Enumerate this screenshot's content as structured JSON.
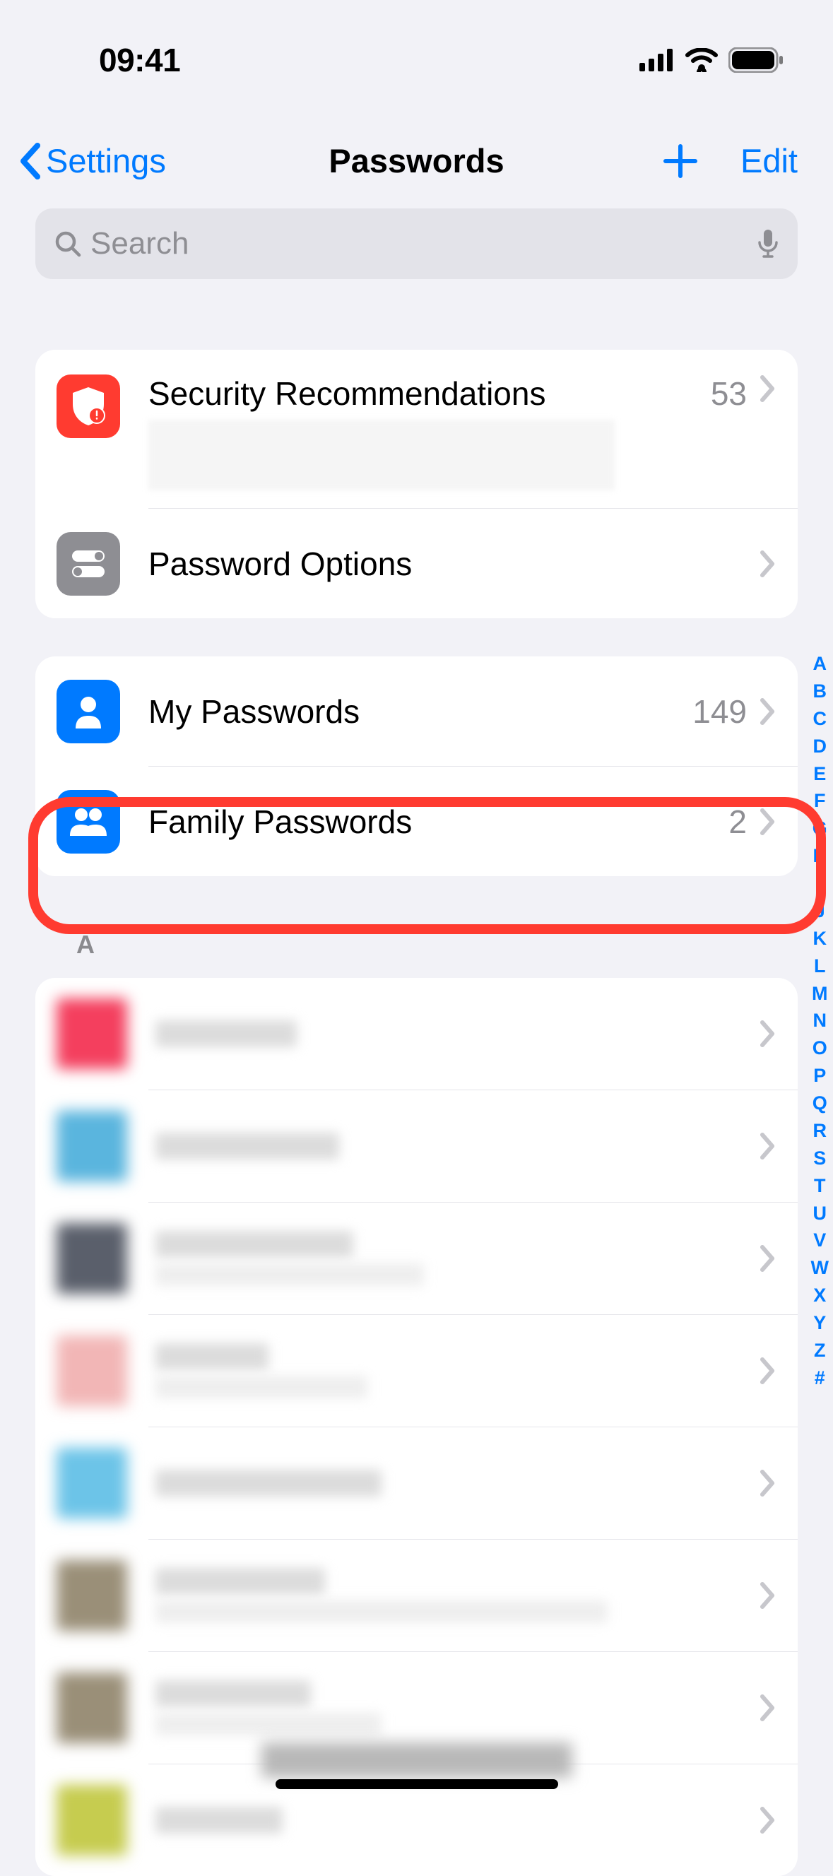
{
  "status": {
    "time": "09:41"
  },
  "nav": {
    "back_label": "Settings",
    "title": "Passwords",
    "edit_label": "Edit"
  },
  "search": {
    "placeholder": "Search"
  },
  "sections": {
    "top": [
      {
        "title": "Security Recommendations",
        "count": "53",
        "icon": "shield-alert",
        "icon_bg": "red"
      },
      {
        "title": "Password Options",
        "count": "",
        "icon": "toggles",
        "icon_bg": "gray"
      }
    ],
    "groups": [
      {
        "title": "My Passwords",
        "count": "149",
        "icon": "person",
        "icon_bg": "blue"
      },
      {
        "title": "Family Passwords",
        "count": "2",
        "icon": "people",
        "icon_bg": "blue"
      }
    ]
  },
  "list": {
    "section_header": "A",
    "items": [
      {
        "icon_color": "#f43f5e",
        "w1": 200,
        "w2": 0
      },
      {
        "icon_color": "#5ab5de",
        "w1": 260,
        "w2": 0
      },
      {
        "icon_color": "#5a5f6b",
        "w1": 280,
        "w2": 380
      },
      {
        "icon_color": "#f2b6b6",
        "w1": 160,
        "w2": 300
      },
      {
        "icon_color": "#6cc4e8",
        "w1": 320,
        "w2": 0
      },
      {
        "icon_color": "#9a8f78",
        "w1": 240,
        "w2": 640
      },
      {
        "icon_color": "#9a8f78",
        "w1": 220,
        "w2": 320
      },
      {
        "icon_color": "#c6cc4f",
        "w1": 180,
        "w2": 0
      }
    ]
  },
  "index": [
    "A",
    "B",
    "C",
    "D",
    "E",
    "F",
    "G",
    "H",
    "I",
    "J",
    "K",
    "L",
    "M",
    "N",
    "O",
    "P",
    "Q",
    "R",
    "S",
    "T",
    "U",
    "V",
    "W",
    "X",
    "Y",
    "Z",
    "#"
  ]
}
